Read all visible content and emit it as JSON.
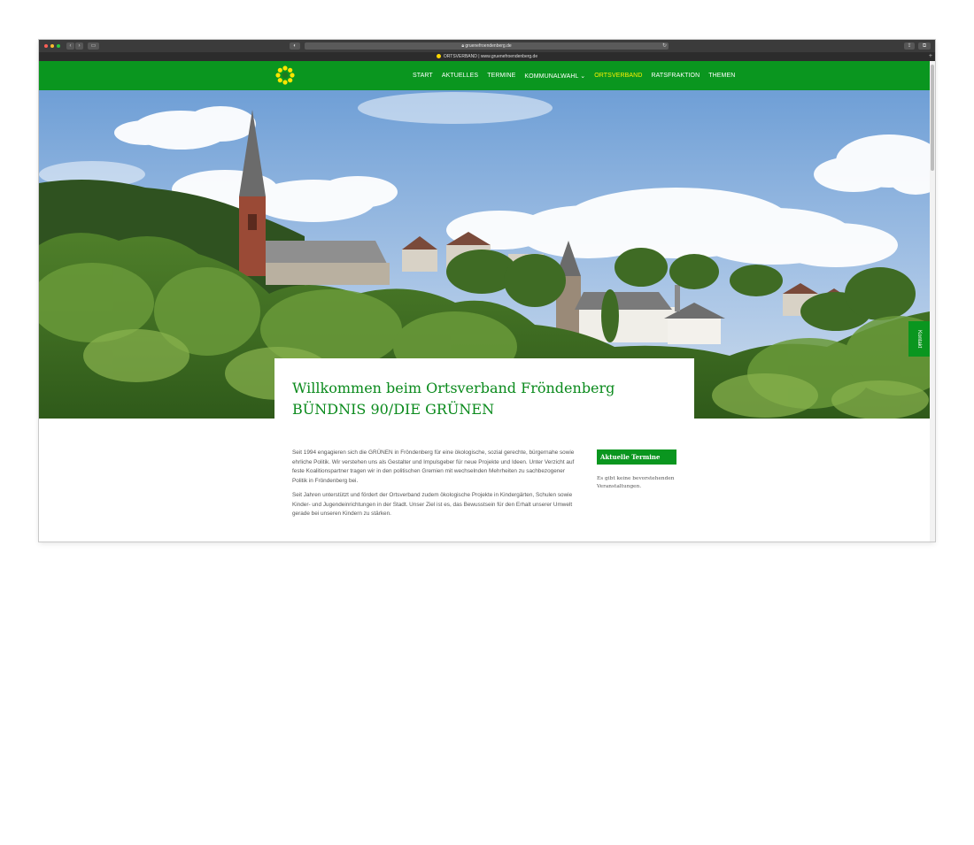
{
  "browser": {
    "url": "gruenefroendenberg.de",
    "tab_title": "ORTSVERBAND | www.gruenefroendenberg.de",
    "back_label": "‹",
    "forward_label": "›",
    "reload_label": "↻",
    "new_tab_label": "+"
  },
  "nav": {
    "items": [
      {
        "label": "START"
      },
      {
        "label": "AKTUELLES"
      },
      {
        "label": "TERMINE"
      },
      {
        "label": "KOMMUNALWAHL ⌄"
      },
      {
        "label": "ORTSVERBAND"
      },
      {
        "label": "RATSFRAKTION"
      },
      {
        "label": "THEMEN"
      }
    ],
    "active_index": 4
  },
  "hero": {
    "kontakt_label": "Kontakt"
  },
  "welcome": {
    "line1": "Willkommen beim Ortsverband Fröndenberg",
    "line2": "BÜNDNIS 90/DIE GRÜNEN"
  },
  "content": {
    "para1": "Seit 1994 engagieren sich die GRÜNEN in Fröndenberg für eine ökologische, sozial gerechte, bürgernahe sowie ehrliche Politik. Wir verstehen uns als Gestalter und Impulsgeber für neue Projekte und Ideen. Unter Verzicht auf feste Koalitionspartner tragen wir in den politischen Gremien mit wechselnden Mehrheiten zu sachbezogener Politik in Fröndenberg bei.",
    "para2": "Seit Jahren unterstützt und fördert der Ortsverband zudem ökologische Projekte in Kindergärten, Schulen sowie Kinder- und Jugendeinrichtungen in der Stadt. Unser Ziel ist es, das Bewusstsein für den Erhalt unserer Umwelt gerade bei unseren Kindern zu stärken."
  },
  "sidebar": {
    "heading": "Aktuelle Termine",
    "empty_text": "Es gibt keine bevorstehenden Veranstaltungen."
  },
  "colors": {
    "brand_green": "#0a961f",
    "title_green": "#0a8a1c",
    "active_yellow": "#fff200"
  }
}
